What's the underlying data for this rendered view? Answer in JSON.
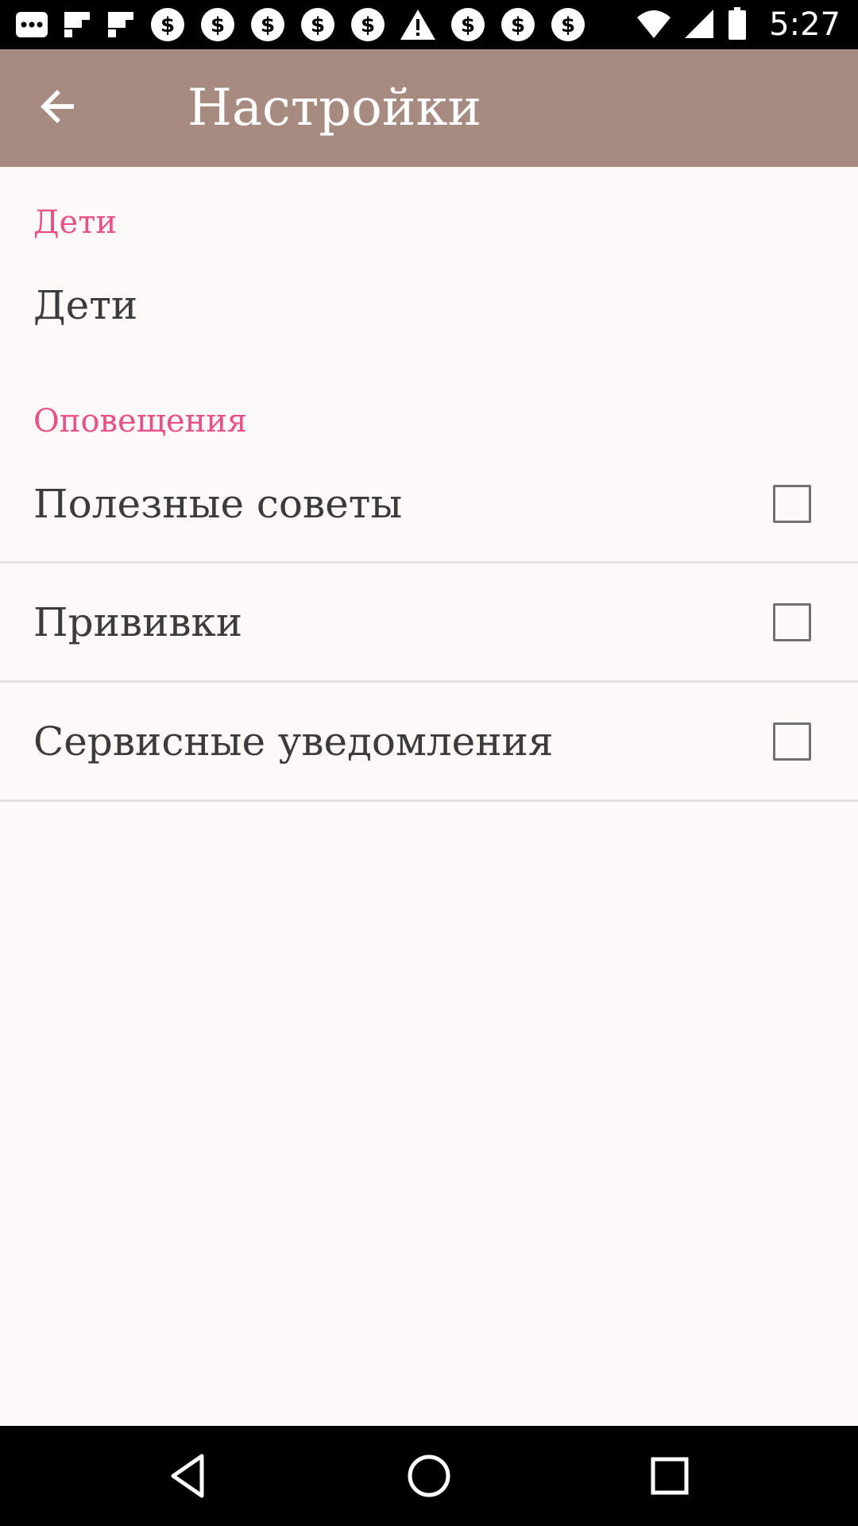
{
  "status_bar": {
    "time": "5:27",
    "icons": [
      "more-icon",
      "flipboard-icon",
      "flipboard-icon",
      "dollar-icon",
      "dollar-icon",
      "dollar-icon",
      "dollar-icon",
      "dollar-icon",
      "warning-icon",
      "dollar-icon",
      "dollar-icon",
      "dollar-icon"
    ],
    "system_icons": [
      "wifi-icon",
      "signal-icon",
      "battery-icon"
    ]
  },
  "app_bar": {
    "back_icon": "arrow-back-icon",
    "title": "Настройки",
    "background_color": "#a78b81"
  },
  "sections": [
    {
      "header": "Дети",
      "items": [
        {
          "title": "Дети"
        }
      ]
    },
    {
      "header": "Оповещения",
      "items": [
        {
          "title": "Полезные советы",
          "checked": false
        },
        {
          "title": "Прививки",
          "checked": false
        },
        {
          "title": "Сервисные уведомления",
          "checked": false
        }
      ]
    }
  ],
  "accent_color": "#e75089",
  "nav_bar": {
    "buttons": [
      "back-triangle-icon",
      "home-circle-icon",
      "recents-square-icon"
    ]
  }
}
